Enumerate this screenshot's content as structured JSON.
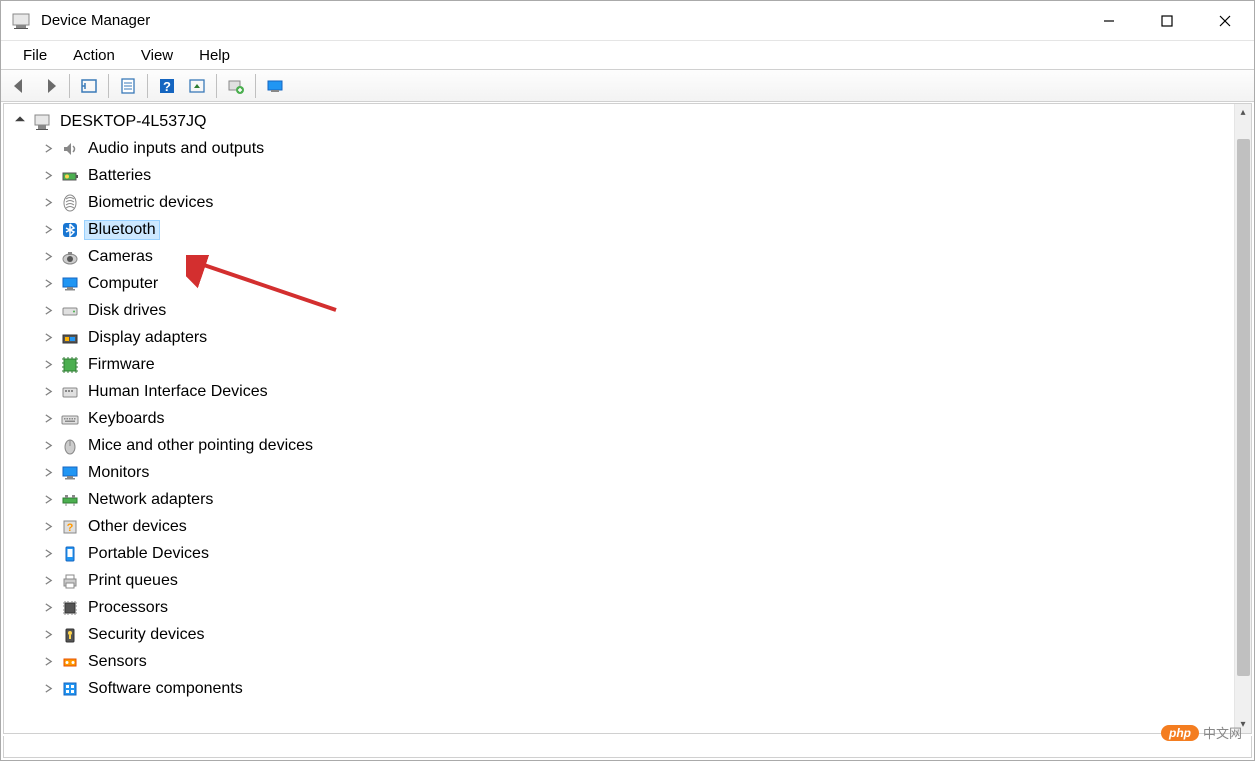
{
  "window": {
    "title": "Device Manager"
  },
  "menubar": {
    "items": [
      "File",
      "Action",
      "View",
      "Help"
    ]
  },
  "toolbar": {
    "buttons": [
      "back",
      "forward",
      "show-hidden",
      "properties",
      "help",
      "update",
      "scan",
      "monitor"
    ]
  },
  "tree": {
    "root": {
      "label": "DESKTOP-4L537JQ",
      "icon": "computer-root-icon",
      "expanded": true
    },
    "nodes": [
      {
        "label": "Audio inputs and outputs",
        "icon": "audio-icon",
        "selected": false
      },
      {
        "label": "Batteries",
        "icon": "battery-icon",
        "selected": false
      },
      {
        "label": "Biometric devices",
        "icon": "biometric-icon",
        "selected": false
      },
      {
        "label": "Bluetooth",
        "icon": "bluetooth-icon",
        "selected": true
      },
      {
        "label": "Cameras",
        "icon": "camera-icon",
        "selected": false
      },
      {
        "label": "Computer",
        "icon": "computer-icon",
        "selected": false
      },
      {
        "label": "Disk drives",
        "icon": "disk-icon",
        "selected": false
      },
      {
        "label": "Display adapters",
        "icon": "display-icon",
        "selected": false
      },
      {
        "label": "Firmware",
        "icon": "firmware-icon",
        "selected": false
      },
      {
        "label": "Human Interface Devices",
        "icon": "hid-icon",
        "selected": false
      },
      {
        "label": "Keyboards",
        "icon": "keyboard-icon",
        "selected": false
      },
      {
        "label": "Mice and other pointing devices",
        "icon": "mouse-icon",
        "selected": false
      },
      {
        "label": "Monitors",
        "icon": "monitor-icon",
        "selected": false
      },
      {
        "label": "Network adapters",
        "icon": "network-icon",
        "selected": false
      },
      {
        "label": "Other devices",
        "icon": "other-icon",
        "selected": false
      },
      {
        "label": "Portable Devices",
        "icon": "portable-icon",
        "selected": false
      },
      {
        "label": "Print queues",
        "icon": "printer-icon",
        "selected": false
      },
      {
        "label": "Processors",
        "icon": "processor-icon",
        "selected": false
      },
      {
        "label": "Security devices",
        "icon": "security-icon",
        "selected": false
      },
      {
        "label": "Sensors",
        "icon": "sensor-icon",
        "selected": false
      },
      {
        "label": "Software components",
        "icon": "software-icon",
        "selected": false
      }
    ]
  },
  "watermark": {
    "badge": "php",
    "text": "中文网"
  }
}
